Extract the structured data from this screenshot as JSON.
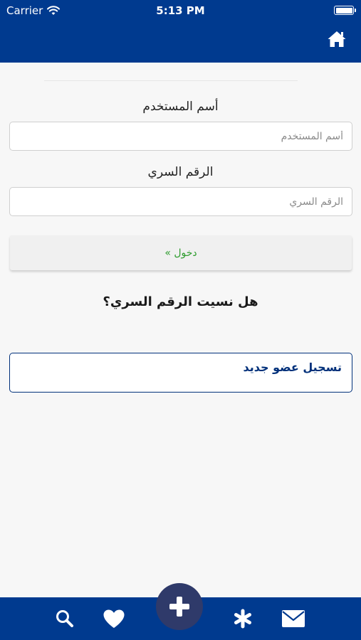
{
  "status_bar": {
    "carrier": "Carrier",
    "time": "5:13 PM",
    "wifi_icon": "wifi-icon",
    "battery_icon": "battery-icon"
  },
  "header": {
    "home_icon": "home-icon",
    "background_color": "#003a8f"
  },
  "form": {
    "username": {
      "label": "أسم المستخدم",
      "placeholder": "أسم المستخدم",
      "value": ""
    },
    "password": {
      "label": "الرقم السري",
      "placeholder": "الرقم السري",
      "value": ""
    },
    "login_label": "دخول »",
    "login_color": "#2e9c2e",
    "forgot_password": "هل نسيت الرقم السري؟",
    "register_label": "تسجيل عضو جديد"
  },
  "tab_bar": {
    "background_color": "#003a8f",
    "items": [
      {
        "icon": "search-icon"
      },
      {
        "icon": "heart-icon"
      },
      {
        "icon": "plus-icon"
      },
      {
        "icon": "asterisk-icon"
      },
      {
        "icon": "mail-icon"
      }
    ]
  }
}
